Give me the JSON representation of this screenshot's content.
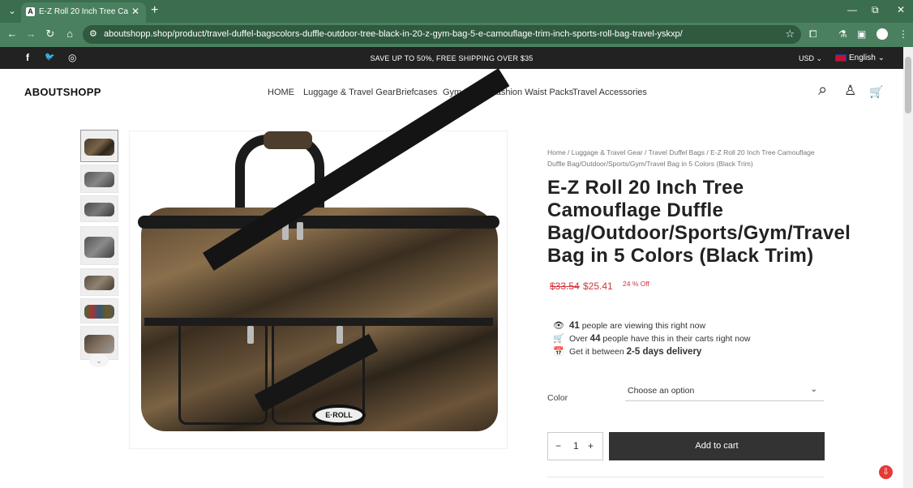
{
  "browser": {
    "tab_title": "E-Z Roll 20 Inch Tree Camoufla...",
    "tab_favicon": "A",
    "url": "aboutshopp.shop/product/travel-duffel-bagscolors-duffle-outdoor-tree-black-in-20-z-gym-bag-5-e-camouflage-trim-inch-sports-roll-bag-travel-yskxp/",
    "icons": {
      "tab_search": "⌄",
      "close": "✕",
      "new_tab": "+",
      "minimize": "—",
      "restore": "⧉",
      "window_close": "✕",
      "back": "←",
      "forward": "→",
      "reload": "↻",
      "home": "⌂",
      "site_info": "⚙",
      "bookmark": "☆",
      "extensions": "⧠",
      "lab": "⚗",
      "sidepanel": "▣",
      "menu": "⋮"
    }
  },
  "topbar": {
    "promo": "SAVE UP TO 50%, FREE SHIPPING OVER $35",
    "currency": "USD ⌄",
    "language": "English ⌄",
    "social": {
      "facebook": "f",
      "twitter": "🐦",
      "instagram": "◎"
    }
  },
  "header": {
    "logo": "ABOUTSHOPP",
    "nav": [
      "HOME",
      "Luggage & Travel Gear",
      "Briefcases",
      "Gym Bags",
      "Fashion Waist Packs",
      "Travel Accessories"
    ],
    "icons": {
      "search": "⌕",
      "account": "♙",
      "cart": "🛒"
    }
  },
  "gallery": {
    "more_arrow": "⌄",
    "bag_logo_text": "E·ROLL"
  },
  "product": {
    "breadcrumbs": "Home  /  Luggage & Travel Gear  /  Travel Duffel Bags  /  E-Z Roll 20 Inch Tree Camouflage Duffle Bag/Outdoor/Sports/Gym/Travel Bag in 5 Colors (Black Trim)",
    "title": "E-Z Roll 20 Inch Tree Camouflage Duffle Bag/Outdoor/Sports/Gym/Travel Bag in 5 Colors (Black Trim)",
    "price_old": "$33.54",
    "price_new": "$25.41",
    "discount": "24 % Off",
    "viewing_count": "41",
    "viewing_text": " people are viewing this right now",
    "carts_prefix": "Over ",
    "carts_count": "44",
    "carts_text": " people have this in their carts right now",
    "delivery_prefix": "Get it between ",
    "delivery_range": "2-5 days delivery",
    "info_icons": {
      "eye": "👁",
      "cart": "🛒",
      "calendar": "📅"
    },
    "color_label": "Color",
    "color_placeholder": "Choose an option",
    "color_chevron": "⌄",
    "qty_minus": "−",
    "qty_value": "1",
    "qty_plus": "+",
    "add_to_cart": "Add to cart"
  },
  "floating": {
    "icon": "⇩"
  }
}
